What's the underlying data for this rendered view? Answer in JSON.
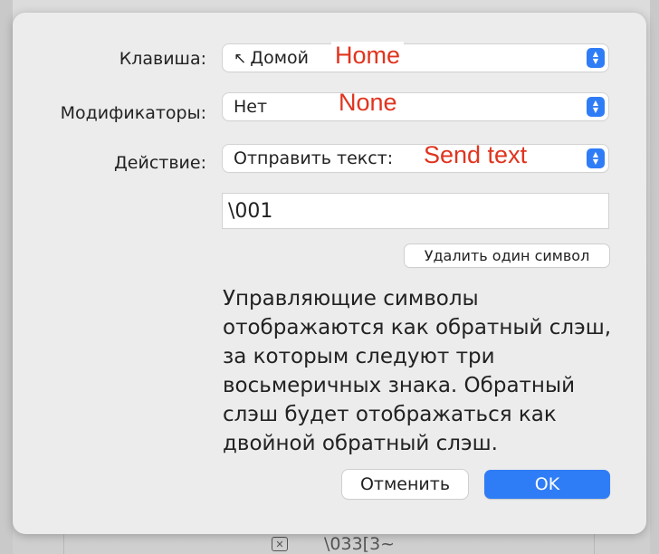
{
  "background": {
    "row_text": "\\033[3~"
  },
  "dialog": {
    "key": {
      "label": "Клавиша:",
      "value": "Домой",
      "value_icon": "arrow-up-left-icon",
      "annotation": "Home"
    },
    "modifiers": {
      "label": "Модификаторы:",
      "value": "Нет",
      "annotation": "None"
    },
    "action": {
      "label": "Действие:",
      "value": "Отправить текст:",
      "annotation": "Send text"
    },
    "text_field": {
      "value": "\\001"
    },
    "delete_char_button": "Удалить один символ",
    "help_text": "Управляющие символы отображаются как обратный слэш, за которым следуют три восьмеричных знака. Обратный слэш будет отображаться как двойной обратный слэш.",
    "cancel_button": "Отменить",
    "ok_button": "OK"
  },
  "colors": {
    "accent": "#2f7df6",
    "annotation": "#e0341f",
    "dialog_bg": "#ececec"
  }
}
